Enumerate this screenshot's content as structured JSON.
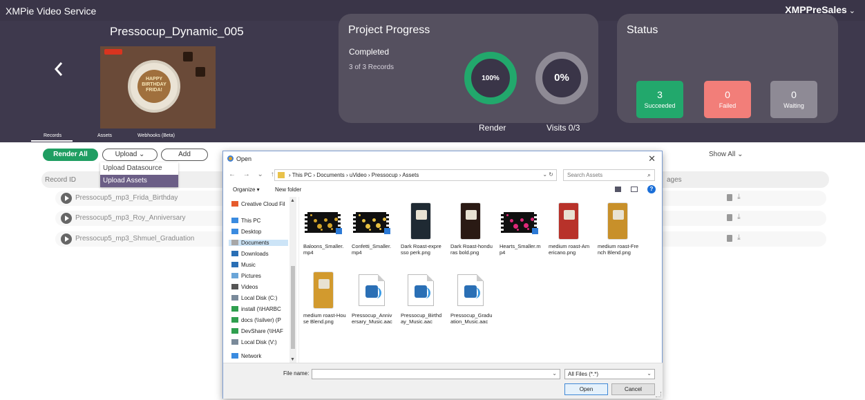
{
  "app": {
    "title": "XMPie Video Service",
    "user": "XMPPreSales",
    "user_chevron": "⌄"
  },
  "project": {
    "name": "Pressocup_Dynamic_005",
    "back_glyph": "‹",
    "thumbnail_text": "HAPPY BIRTHDAY FRIDA!"
  },
  "progress": {
    "title": "Project Progress",
    "state": "Completed",
    "records": "3 of 3 Records",
    "render_value": "100%",
    "render_label": "Render",
    "visits_value": "0%",
    "visits_label": "Visits 0/3"
  },
  "status": {
    "title": "Status",
    "succeeded": {
      "count": "3",
      "label": "Succeeded",
      "color": "#22a86c"
    },
    "failed": {
      "count": "0",
      "label": "Failed",
      "color": "#f27e79"
    },
    "waiting": {
      "count": "0",
      "label": "Waiting",
      "color": "#8e8a95"
    }
  },
  "tabs": [
    {
      "label": "Records"
    },
    {
      "label": "Assets"
    },
    {
      "label": "Webhooks (Beta)"
    }
  ],
  "actions": {
    "render_all": "Render All",
    "upload": "Upload ⌄",
    "add": "Add",
    "show_all": "Show All ⌄"
  },
  "upload_menu": [
    {
      "label": "Upload Datasource"
    },
    {
      "label": "Upload Assets"
    }
  ],
  "table": {
    "col_id": "Record ID",
    "col_images": "ages",
    "rows": [
      {
        "name": "Pressocup5_mp3_Frida_Birthday"
      },
      {
        "name": "Pressocup5_mp3_Roy_Anniversary"
      },
      {
        "name": "Pressocup5_mp3_Shmuel_Graduation"
      }
    ],
    "download_glyph": "⤓"
  },
  "dialog": {
    "title": "Open",
    "close": "✕",
    "nav": "←  →  ⌄  ↑",
    "breadcrumb": "›  This PC  ›  Documents  ›  uVideo  ›  Pressocup  ›  Assets",
    "addr_ctrl": "⌄  ↻",
    "search_placeholder": "Search Assets",
    "search_icon": "⌕",
    "organize": "Organize ▾",
    "new_folder": "New folder",
    "help": "?",
    "nav_items": [
      {
        "label": "Creative Cloud Fil",
        "icon": "cloud-folder-icon",
        "color": "#e55b2c"
      },
      {
        "label": "This PC",
        "icon": "pc-icon",
        "color": "#3a8be0"
      },
      {
        "label": "Desktop",
        "icon": "desktop-icon",
        "color": "#3a8be0"
      },
      {
        "label": "Documents",
        "icon": "documents-icon",
        "color": "#a7a7a7"
      },
      {
        "label": "Downloads",
        "icon": "download-icon",
        "color": "#2a6fb5"
      },
      {
        "label": "Music",
        "icon": "music-icon",
        "color": "#2a6fb5"
      },
      {
        "label": "Pictures",
        "icon": "pictures-icon",
        "color": "#6aa5d8"
      },
      {
        "label": "Videos",
        "icon": "videos-icon",
        "color": "#555555"
      },
      {
        "label": "Local Disk (C:)",
        "icon": "disk-icon",
        "color": "#7a8a9a"
      },
      {
        "label": "install (\\\\HARBC",
        "icon": "network-drive-icon",
        "color": "#2f9f4f"
      },
      {
        "label": "docs (\\\\silver) (P",
        "icon": "network-drive-icon",
        "color": "#2f9f4f"
      },
      {
        "label": "DevShare (\\\\HAF",
        "icon": "network-drive-icon",
        "color": "#2f9f4f"
      },
      {
        "label": "Local Disk (V:)",
        "icon": "disk-icon",
        "color": "#7a8a9a"
      },
      {
        "label": "Network",
        "icon": "network-icon",
        "color": "#3a8be0"
      }
    ],
    "files": [
      {
        "name": "Baloons_Smaller.mp4",
        "kind": "video",
        "theme": "#d4a52a"
      },
      {
        "name": "Confetti_Smaller.mp4",
        "kind": "video",
        "theme": "#e7c040"
      },
      {
        "name": "Dark Roast-expresso perk.png",
        "kind": "bag",
        "theme": "#1f2a33"
      },
      {
        "name": "Dark Roast-honduras bold.png",
        "kind": "bag",
        "theme": "#2a1a14"
      },
      {
        "name": "Hearts_Smaller.mp4",
        "kind": "video",
        "theme": "#e0287a"
      },
      {
        "name": "medium roast-Americano.png",
        "kind": "bag",
        "theme": "#b8322a"
      },
      {
        "name": "medium roast-French Blend.png",
        "kind": "bag",
        "theme": "#c8902a"
      },
      {
        "name": "medium roast-House Blend.png",
        "kind": "bag",
        "theme": "#d29a2e"
      },
      {
        "name": "Pressocup_Anniversary_Music.aac",
        "kind": "audio",
        "theme": "#2a6fb5"
      },
      {
        "name": "Pressocup_Birthday_Music.aac",
        "kind": "audio",
        "theme": "#2a6fb5"
      },
      {
        "name": "Pressocup_Graduation_Music.aac",
        "kind": "audio",
        "theme": "#2a6fb5"
      }
    ],
    "file_name_label": "File name:",
    "file_name_value": "",
    "file_type": "All Files (*.*)",
    "open": "Open",
    "cancel": "Cancel"
  }
}
